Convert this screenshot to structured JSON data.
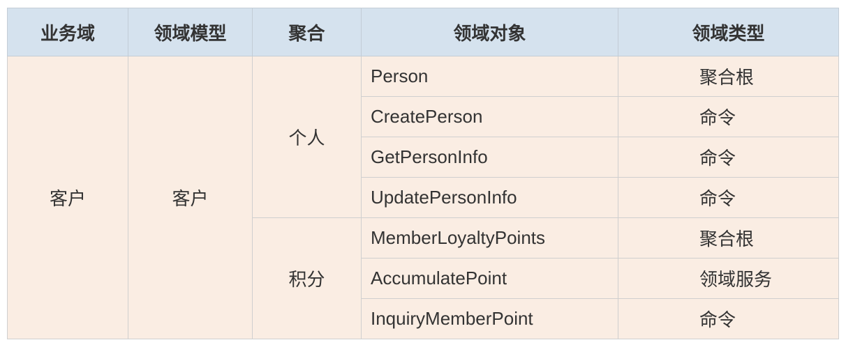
{
  "table": {
    "headers": [
      "业务域",
      "领域模型",
      "聚合",
      "领域对象",
      "领域类型"
    ],
    "domain": "客户",
    "model": "客户",
    "aggregates": [
      {
        "name": "个人",
        "objects": [
          {
            "name": "Person",
            "type": "聚合根"
          },
          {
            "name": "CreatePerson",
            "type": "命令"
          },
          {
            "name": "GetPersonInfo",
            "type": "命令"
          },
          {
            "name": "UpdatePersonInfo",
            "type": "命令"
          }
        ]
      },
      {
        "name": "积分",
        "objects": [
          {
            "name": "MemberLoyaltyPoints",
            "type": "聚合根"
          },
          {
            "name": "AccumulatePoint",
            "type": "领域服务"
          },
          {
            "name": "InquiryMemberPoint",
            "type": "命令"
          }
        ]
      }
    ]
  },
  "colors": {
    "header_bg": "#d5e2ee",
    "body_bg": "#faede3",
    "border": "#cfcfcf",
    "text": "#333333"
  }
}
